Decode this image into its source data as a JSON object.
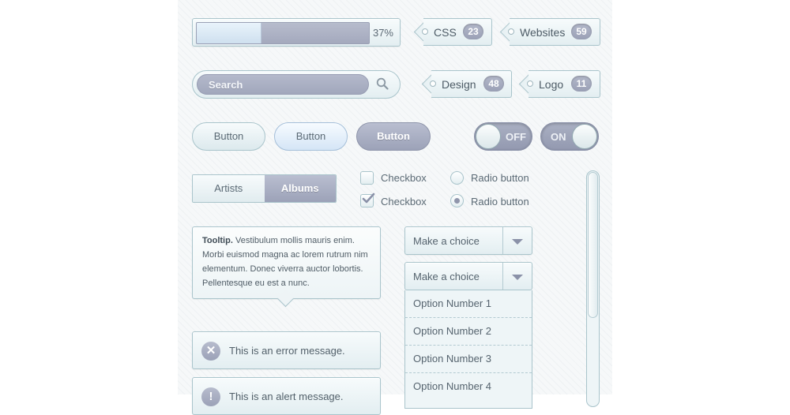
{
  "progress": {
    "value": 0.37,
    "label": "37%"
  },
  "tags": [
    {
      "label": "CSS",
      "count": "23"
    },
    {
      "label": "Websites",
      "count": "59"
    },
    {
      "label": "Design",
      "count": "48"
    },
    {
      "label": "Logo",
      "count": "11"
    }
  ],
  "search": {
    "placeholder": "Search"
  },
  "buttons": [
    {
      "label": "Button",
      "style": "light"
    },
    {
      "label": "Button",
      "style": "blue"
    },
    {
      "label": "Button",
      "style": "dark"
    }
  ],
  "toggles": {
    "off_label": "OFF",
    "on_label": "ON"
  },
  "segmented": {
    "items": [
      "Artists",
      "Albums"
    ],
    "selected": "Albums"
  },
  "checkboxes": [
    {
      "label": "Checkbox",
      "checked": false
    },
    {
      "label": "Checkbox",
      "checked": true
    }
  ],
  "radios": [
    {
      "label": "Radio button",
      "selected": false
    },
    {
      "label": "Radio button",
      "selected": true
    }
  ],
  "tooltip": {
    "title": "Tooltip.",
    "body": "Vestibulum mollis mauris enim. Morbi euismod magna ac lorem rutrum nim elementum. Donec viverra auctor lobortis. Pellentesque eu est a nunc."
  },
  "messages": {
    "error": "This is an error message.",
    "alert": "This is an alert message."
  },
  "select_closed": {
    "value": "Make a choice"
  },
  "select_open": {
    "value": "Make a choice",
    "options": [
      "Option Number 1",
      "Option Number 2",
      "Option Number 3",
      "Option Number 4"
    ]
  },
  "colors": {
    "accent": "#a4a9bd",
    "border": "#a9c4cb",
    "panel": "#e3eef1"
  }
}
